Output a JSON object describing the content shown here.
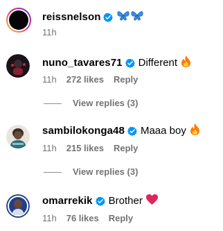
{
  "comments": [
    {
      "username": "reissnelson",
      "text": "",
      "emoji": "butterflies",
      "time": "11h",
      "likes": "",
      "reply": ""
    },
    {
      "username": "nuno_tavares71",
      "text": "Different",
      "emoji": "fire",
      "time": "11h",
      "likes": "272 likes",
      "reply": "Reply",
      "view_replies": "View replies (3)"
    },
    {
      "username": "sambilokonga48",
      "text": "Maaa boy",
      "emoji": "fire",
      "time": "11h",
      "likes": "215 likes",
      "reply": "Reply",
      "view_replies": "View replies (3)"
    },
    {
      "username": "omarrekik",
      "text": "Brother",
      "emoji": "red-heart",
      "time": "11h",
      "likes": "76 likes",
      "reply": "Reply"
    }
  ],
  "colors": {
    "verified": "#0095f6",
    "muted": "#737373",
    "story_ring_start": "#f9ce34",
    "story_ring_end": "#ee2a7b",
    "fire": "#ff7a00",
    "heart": "#e0245e"
  }
}
